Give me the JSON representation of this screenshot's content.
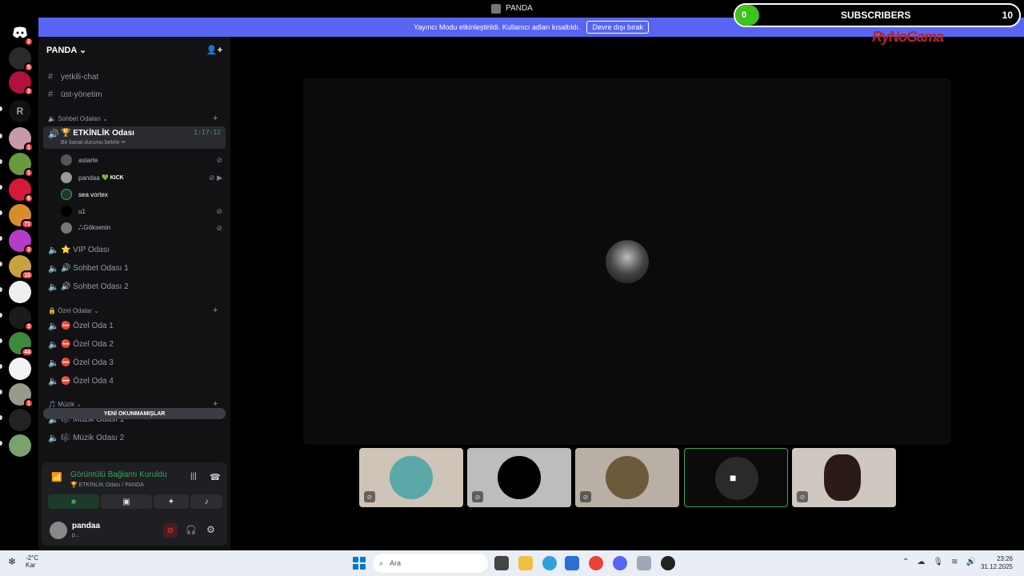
{
  "window": {
    "title": "PANDA"
  },
  "banner": {
    "message": "Yayıncı Modu etkinleştirildi. Kullanıcı adları kısaltıldı.",
    "button": "Devre dışı bırak"
  },
  "overlay": {
    "count_left": "0",
    "label": "SUBSCRIBERS",
    "count_right": "10",
    "logo": "RyNoGama"
  },
  "rail": {
    "badges": [
      "2",
      "5",
      "3",
      "1",
      "1",
      "6",
      "71",
      "3",
      "10",
      "3",
      "44",
      "1"
    ],
    "letter_server": "R"
  },
  "guild": {
    "name": "PANDA"
  },
  "channels": {
    "text": [
      {
        "name": "yetkili-chat"
      },
      {
        "name": "üst-yönetim"
      }
    ],
    "category_chat": "Sohbet Odaları",
    "active": {
      "name": "🏆 ETKİNLİK Odası",
      "status": "Bir kanal durumu belirle ✏",
      "timer": "1:17:12"
    },
    "members": [
      {
        "name": "astarte"
      },
      {
        "name": "pandaa",
        "tag": "💚 KICK"
      },
      {
        "name": "sea vortex"
      },
      {
        "name": "u1"
      },
      {
        "name": "ஃGöksenin"
      }
    ],
    "voice": [
      {
        "name": "⭐ VIP Odası"
      },
      {
        "name": "🔊 Sohbet Odası 1"
      },
      {
        "name": "🔊 Sohbet Odası 2"
      }
    ],
    "category_private": "Özel Odalar",
    "private": [
      {
        "name": "⛔ Özel Oda 1"
      },
      {
        "name": "⛔ Özel Oda 2"
      },
      {
        "name": "⛔ Özel Oda 3"
      },
      {
        "name": "⛔ Özel Oda 4"
      }
    ],
    "category_music": "Müzik",
    "music": [
      {
        "name": "🎼 Müzik Odası 1"
      },
      {
        "name": "🎼 Müzik Odası 2"
      }
    ],
    "unread_pill": "YENİ OKUNMAMIŞLAR"
  },
  "voice_panel": {
    "title": "Görüntülü Bağlantı Kuruldu",
    "subtitle": "🏆 ETKİNLİK Odası / PANDA",
    "user_name": "pandaa",
    "user_status": "p..."
  },
  "taskbar": {
    "weather_temp": "-2°C",
    "weather_loc": "Kar",
    "search_placeholder": "Ara",
    "time": "23:26",
    "date": "31.12.2025"
  },
  "colors": {
    "accent": "#5865f2",
    "online": "#3ba55d",
    "danger": "#f23f43",
    "sub_badge": "#3ec31a"
  }
}
